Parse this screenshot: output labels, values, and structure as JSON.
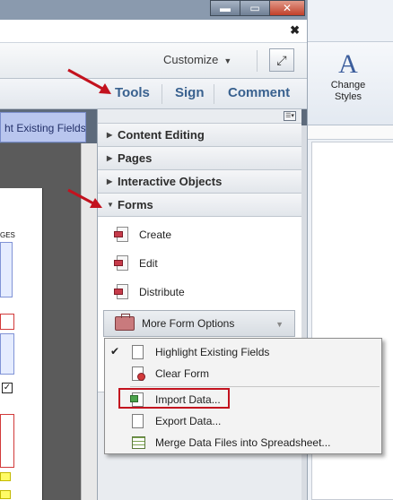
{
  "word": {
    "change_styles_label_1": "Change",
    "change_styles_label_2": "Styles",
    "change_styles_glyph": "A"
  },
  "acrobat": {
    "window_buttons": {
      "minimize": "▬",
      "restore": "▭",
      "close": "✕"
    },
    "close_pane_glyph": "✖",
    "customize_label": "Customize",
    "tabs": {
      "tools": "Tools",
      "sign": "Sign",
      "comment": "Comment"
    },
    "highlight_bar_text": "ht Existing Fields",
    "doc_text_pages": "GES"
  },
  "panel": {
    "sections": {
      "content_editing": "Content Editing",
      "pages": "Pages",
      "interactive_objects": "Interactive Objects",
      "forms": "Forms"
    },
    "forms_tools": {
      "create": "Create",
      "edit": "Edit",
      "distribute": "Distribute",
      "more_form_options": "More Form Options"
    }
  },
  "flyout": {
    "highlight_existing_fields": "Highlight Existing Fields",
    "clear_form": "Clear Form",
    "import_data": "Import Data...",
    "export_data": "Export Data...",
    "merge_data_files": "Merge Data Files into Spreadsheet..."
  },
  "colors": {
    "annotation_red": "#c3121e",
    "tab_blue": "#39618f",
    "highlight_bar": "#b9c6ee"
  }
}
